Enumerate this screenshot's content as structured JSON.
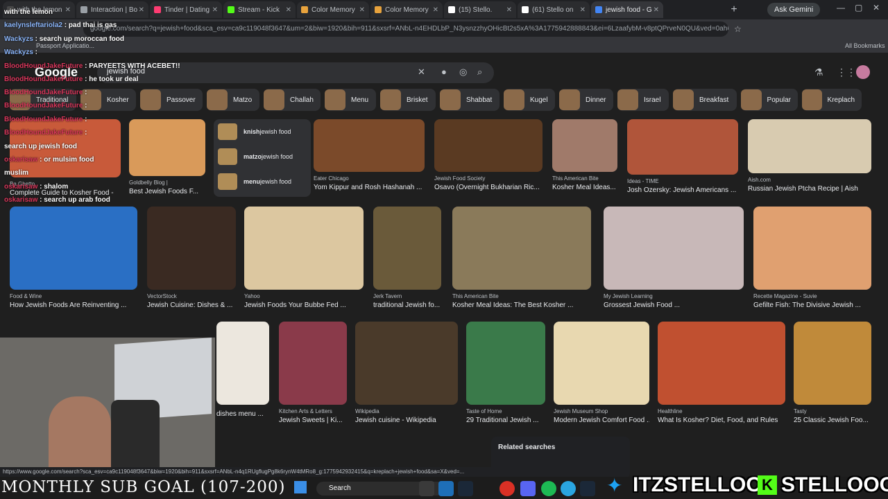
{
  "tabs": [
    {
      "label": "with the lemon",
      "color": "#4a4a4a"
    },
    {
      "label": "Interaction | Bo",
      "color": "#9aa0a6"
    },
    {
      "label": "Tinder | Dating",
      "color": "#fe3c72"
    },
    {
      "label": "Stream - Kick",
      "color": "#53fc18"
    },
    {
      "label": "Color Memory",
      "color": "#e8a33d"
    },
    {
      "label": "Color Memory",
      "color": "#e8a33d"
    },
    {
      "label": "(15) Stello.",
      "color": "#ffffff"
    },
    {
      "label": "(61) Stello on",
      "color": "#ffffff"
    },
    {
      "label": "jewish food - G",
      "color": "#4285f4"
    }
  ],
  "browser": {
    "ask_gemini": "Ask Gemini",
    "url": "google.com/search?q=jewish+food&sca_esv=ca9c119048f3647&um=2&biw=1920&bih=911&sxsrf=ANbL-n4EHDLbP_N3ysnzzhyOHicBt2s5xA%3A1775942888843&ei=6LzaafybM-v8ptQPrveN0QU&ved=0ahUKEwj...",
    "bookmark": "Passport Applicatio...",
    "all_bookmarks": "All Bookmarks"
  },
  "google": {
    "logo": "Google",
    "query": "jewish food"
  },
  "chips": [
    "Traditional",
    "Kosher",
    "Passover",
    "Matzo",
    "Challah",
    "Menu",
    "Brisket",
    "Shabbat",
    "Kugel",
    "Dinner",
    "Israel",
    "Breakfast",
    "Popular",
    "Kreplach"
  ],
  "suggestions": [
    {
      "bold": "knish",
      "rest": " jewish food"
    },
    {
      "bold": "matzo",
      "rest": " jewish food"
    },
    {
      "bold": "menu",
      "rest": " jewish food"
    }
  ],
  "results_row1": [
    {
      "src": "Goldbelly Blog |",
      "title": "Best Jewish Foods F...",
      "color": "#d99a5a"
    },
    {
      "src": "Eater Chicago",
      "title": "Yom Kippur and Rosh Hashanah ...",
      "color": "#7b4a2a"
    },
    {
      "src": "Jewish Food Society",
      "title": "Osavo (Overnight Bukharian Ric...",
      "color": "#5a3a22"
    },
    {
      "src": "This American Bite",
      "title": "Kosher Meal Ideas...",
      "color": "#a07a6a"
    },
    {
      "src": "Ideas - TIME",
      "title": "Josh Ozersky: Jewish Americans ...",
      "color": "#b0553a"
    },
    {
      "src": "Aish.com",
      "title": "Russian Jewish Ptcha Recipe | Aish",
      "color": "#d8cbb0"
    }
  ],
  "partial_row1": {
    "src": "Ba Ghetto",
    "title": "Complete Guide to Kosher Food -",
    "color": "#c85a3a"
  },
  "results_row2": [
    {
      "src": "Food & Wine",
      "title": "How Jewish Foods Are Reinventing ...",
      "color": "#2a6fc4"
    },
    {
      "src": "VectorStock",
      "title": "Jewish Cuisine: Dishes & ...",
      "color": "#3a2a22"
    },
    {
      "src": "Yahoo",
      "title": "Jewish Foods Your Bubbe Fed ...",
      "color": "#dcc7a0"
    },
    {
      "src": "Jerk Tavern",
      "title": "traditional Jewish fo...",
      "color": "#6a5a3a"
    },
    {
      "src": "This American Bite",
      "title": "Kosher Meal Ideas: The Best Kosher ...",
      "color": "#8a7a5a"
    },
    {
      "src": "My Jewish Learning",
      "title": "Grossest Jewish Food ...",
      "color": "#c8b8b8"
    },
    {
      "src": "Recette Magazine - Suvie",
      "title": "Gefilte Fish: The Divisive Jewish ...",
      "color": "#e0a070"
    }
  ],
  "results_row3": [
    {
      "src": "",
      "title": "dishes menu ...",
      "color": "#ece7de"
    },
    {
      "src": "Kitchen Arts & Letters",
      "title": "Jewish Sweets | Ki...",
      "color": "#8a3a4a"
    },
    {
      "src": "Wikipedia",
      "title": "Jewish cuisine - Wikipedia",
      "color": "#4a3a2a"
    },
    {
      "src": "Taste of Home",
      "title": "29 Traditional Jewish ...",
      "color": "#3a7a4a"
    },
    {
      "src": "Jewish Museum Shop",
      "title": "Modern Jewish Comfort Food ...",
      "color": "#e8d8b0"
    },
    {
      "src": "Healthline",
      "title": "What Is Kosher? Diet, Food, and Rules",
      "color": "#c05030"
    },
    {
      "src": "Tasty",
      "title": "25 Classic Jewish Foo...",
      "color": "#c08a3a"
    }
  ],
  "related_searches": "Related searches",
  "chat": [
    {
      "user": "",
      "msg": "with the lemon"
    },
    {
      "user": "kaelynsleftariola2",
      "msg": "pad thai is gas"
    },
    {
      "user": "Wackyzs",
      "msg": "search up moroccan food"
    },
    {
      "user": "Wackyzs",
      "msg": ""
    },
    {
      "user": "BloodHoundJakeFuture",
      "msg": "PARYEETS WITH ACEBET!!"
    },
    {
      "user": "BloodHoundJakeFuture",
      "msg": "he took ur deal"
    },
    {
      "user": "BloodHoundJakeFuture",
      "msg": ""
    },
    {
      "user": "BloodHoundJakeFuture",
      "msg": ""
    },
    {
      "user": "BloodHoundJakeFuture",
      "msg": ""
    },
    {
      "user": "BloodHoundJakeFuture",
      "msg": ""
    },
    {
      "user": "",
      "msg": "search up jewish food"
    },
    {
      "user": "oskarisaw",
      "msg": "or mulsim food"
    },
    {
      "user": "",
      "msg": "muslim"
    },
    {
      "user": "oskarisaw",
      "msg": "shalom"
    },
    {
      "user": "oskarisaw",
      "msg": "search up arab food"
    }
  ],
  "status_url": "https://www.google.com/search?sca_esv=ca9c119048f3647&biw=1920&bih=911&sxsrf=ANbL-n4q1RUgflugPg8k6rynW4tMRo8_g:1775942932415&q=kreplach+jewish+food&sa=X&ved=...",
  "overlay": {
    "subgoal": "MONTHLY SUB GOAL (107-200)",
    "twitter": "ITZSTELLOO",
    "kick": "STELLOOO"
  },
  "taskbar": {
    "search_label": "Search"
  }
}
